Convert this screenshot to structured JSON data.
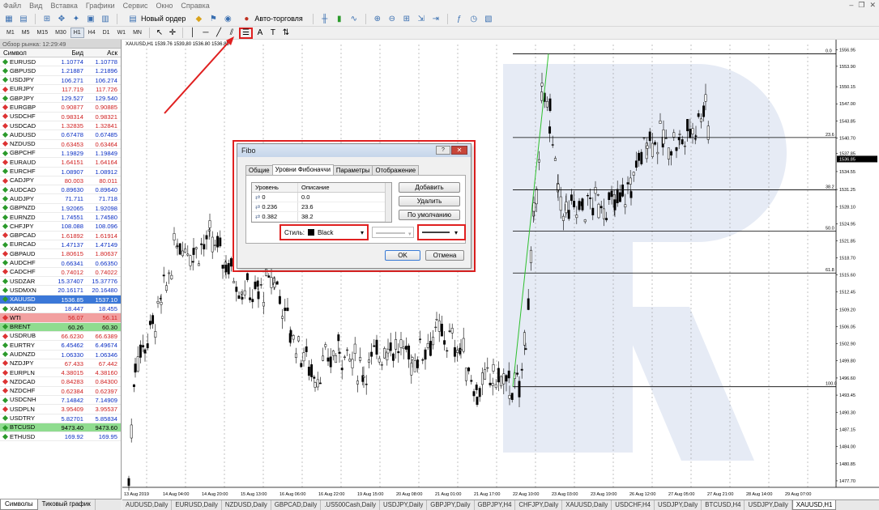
{
  "menu": [
    "Файл",
    "Вид",
    "Вставка",
    "Графики",
    "Сервис",
    "Окно",
    "Справка"
  ],
  "toolbar": {
    "new_order": "Новый ордер",
    "autotrade": "Авто-торговля"
  },
  "timeframes": [
    "M1",
    "M5",
    "M15",
    "M30",
    "H1",
    "H4",
    "D1",
    "W1",
    "MN"
  ],
  "active_timeframe": "H1",
  "market_watch": {
    "title": "Обзор рынка: 12:29:49",
    "headers": {
      "symbol": "Символ",
      "bid": "Бид",
      "ask": "Аск"
    },
    "rows": [
      {
        "s": "EURUSD",
        "b": "1.10774",
        "a": "1.10778",
        "d": "up"
      },
      {
        "s": "GBPUSD",
        "b": "1.21887",
        "a": "1.21896",
        "d": "up"
      },
      {
        "s": "USDJPY",
        "b": "106.271",
        "a": "106.274",
        "d": "up"
      },
      {
        "s": "EURJPY",
        "b": "117.719",
        "a": "117.726",
        "d": "down"
      },
      {
        "s": "GBPJPY",
        "b": "129.527",
        "a": "129.540",
        "d": "up"
      },
      {
        "s": "EURGBP",
        "b": "0.90877",
        "a": "0.90885",
        "d": "down"
      },
      {
        "s": "USDCHF",
        "b": "0.98314",
        "a": "0.98321",
        "d": "down"
      },
      {
        "s": "USDCAD",
        "b": "1.32835",
        "a": "1.32841",
        "d": "down"
      },
      {
        "s": "AUDUSD",
        "b": "0.67478",
        "a": "0.67485",
        "d": "up"
      },
      {
        "s": "NZDUSD",
        "b": "0.63453",
        "a": "0.63464",
        "d": "down"
      },
      {
        "s": "GBPCHF",
        "b": "1.19829",
        "a": "1.19849",
        "d": "up"
      },
      {
        "s": "EURAUD",
        "b": "1.64151",
        "a": "1.64164",
        "d": "down"
      },
      {
        "s": "EURCHF",
        "b": "1.08907",
        "a": "1.08912",
        "d": "up"
      },
      {
        "s": "CADJPY",
        "b": "80.003",
        "a": "80.011",
        "d": "down"
      },
      {
        "s": "AUDCAD",
        "b": "0.89630",
        "a": "0.89640",
        "d": "up"
      },
      {
        "s": "AUDJPY",
        "b": "71.711",
        "a": "71.718",
        "d": "up"
      },
      {
        "s": "GBPNZD",
        "b": "1.92065",
        "a": "1.92098",
        "d": "up"
      },
      {
        "s": "EURNZD",
        "b": "1.74551",
        "a": "1.74580",
        "d": "up"
      },
      {
        "s": "CHFJPY",
        "b": "108.088",
        "a": "108.096",
        "d": "up"
      },
      {
        "s": "GBPCAD",
        "b": "1.61892",
        "a": "1.61914",
        "d": "down"
      },
      {
        "s": "EURCAD",
        "b": "1.47137",
        "a": "1.47149",
        "d": "up"
      },
      {
        "s": "GBPAUD",
        "b": "1.80615",
        "a": "1.80637",
        "d": "down"
      },
      {
        "s": "AUDCHF",
        "b": "0.66341",
        "a": "0.66350",
        "d": "up"
      },
      {
        "s": "CADCHF",
        "b": "0.74012",
        "a": "0.74022",
        "d": "down"
      },
      {
        "s": "USDZAR",
        "b": "15.37407",
        "a": "15.37776",
        "d": "up"
      },
      {
        "s": "USDMXN",
        "b": "20.16171",
        "a": "20.16480",
        "d": "up"
      },
      {
        "s": "XAUUSD",
        "b": "1536.85",
        "a": "1537.10",
        "d": "sel"
      },
      {
        "s": "XAGUSD",
        "b": "18.447",
        "a": "18.455",
        "d": "up"
      },
      {
        "s": "WTI",
        "b": "56.07",
        "a": "56.11",
        "d": "hl_red"
      },
      {
        "s": "BRENT",
        "b": "60.26",
        "a": "60.30",
        "d": "hl_green"
      },
      {
        "s": "USDRUB",
        "b": "66.6230",
        "a": "66.6389",
        "d": "down"
      },
      {
        "s": "EURTRY",
        "b": "6.45462",
        "a": "6.49674",
        "d": "up"
      },
      {
        "s": "AUDNZD",
        "b": "1.06330",
        "a": "1.06346",
        "d": "up"
      },
      {
        "s": "NZDJPY",
        "b": "67.433",
        "a": "67.442",
        "d": "down"
      },
      {
        "s": "EURPLN",
        "b": "4.38015",
        "a": "4.38160",
        "d": "down"
      },
      {
        "s": "NZDCAD",
        "b": "0.84283",
        "a": "0.84300",
        "d": "down"
      },
      {
        "s": "NZDCHF",
        "b": "0.62384",
        "a": "0.62397",
        "d": "down"
      },
      {
        "s": "USDCNH",
        "b": "7.14842",
        "a": "7.14909",
        "d": "up"
      },
      {
        "s": "USDPLN",
        "b": "3.95409",
        "a": "3.95537",
        "d": "down"
      },
      {
        "s": "USDTRY",
        "b": "5.82701",
        "a": "5.85834",
        "d": "up"
      },
      {
        "s": "BTCUSD",
        "b": "9473.40",
        "a": "9473.60",
        "d": "hl_green"
      },
      {
        "s": "ETHUSD",
        "b": "169.92",
        "a": "169.95",
        "d": "up"
      }
    ],
    "tabs": [
      "Символы",
      "Тиковый график"
    ]
  },
  "chart": {
    "title": "XAUUSD,H1 1539.76 1539.80 1536.80 1536.85",
    "price_labels": [
      "1556.95",
      "1553.90",
      "1550.15",
      "1547.00",
      "1543.85",
      "1540.70",
      "1537.85",
      "1534.55",
      "1531.25",
      "1528.10",
      "1524.95",
      "1521.85",
      "1518.70",
      "1515.60",
      "1512.45",
      "1509.20",
      "1506.05",
      "1502.90",
      "1499.80",
      "1496.60",
      "1493.45",
      "1490.30",
      "1487.15",
      "1484.00",
      "1480.85",
      "1477.70"
    ],
    "current_price": "1536.85",
    "time_labels": [
      "13 Aug 2019",
      "14 Aug 04:00",
      "14 Aug 20:00",
      "15 Aug 13:00",
      "16 Aug 06:00",
      "16 Aug 22:00",
      "19 Aug 15:00",
      "20 Aug 08:00",
      "21 Aug 01:00",
      "21 Aug 17:00",
      "22 Aug 10:00",
      "23 Aug 03:00",
      "23 Aug 19:00",
      "26 Aug 12:00",
      "27 Aug 05:00",
      "27 Aug 21:00",
      "28 Aug 14:00",
      "29 Aug 07:00"
    ],
    "fibo_levels": [
      "0.0",
      "23.6",
      "38.2",
      "50.0",
      "61.8",
      "100.0"
    ]
  },
  "bottom_tabs": [
    "AUDUSD,Daily",
    "EURUSD,Daily",
    "NZDUSD,Daily",
    "GBPCAD,Daily",
    ".US500Cash,Daily",
    "USDJPY,Daily",
    "GBPJPY,Daily",
    "GBPJPY,H4",
    "CHFJPY,Daily",
    "XAUUSD,Daily",
    "USDCHF,H4",
    "USDJPY,Daily",
    "BTCUSD,H4",
    "USDJPY,Daily",
    "XAUUSD,H1"
  ],
  "dialog": {
    "title": "Fibo",
    "tabs": [
      "Общие",
      "Уровни Фибоначчи",
      "Параметры",
      "Отображение"
    ],
    "active_tab": "Уровни Фибоначчи",
    "grid_headers": {
      "level": "Уровень",
      "desc": "Описание"
    },
    "grid_rows": [
      {
        "level": "0",
        "desc": "0.0"
      },
      {
        "level": "0.236",
        "desc": "23.6"
      },
      {
        "level": "0.382",
        "desc": "38.2"
      }
    ],
    "buttons": {
      "add": "Добавить",
      "delete": "Удалить",
      "default": "По умолчанию",
      "ok": "OK",
      "cancel": "Отмена"
    },
    "style_label": "Стиль:",
    "style_value": "Black"
  }
}
